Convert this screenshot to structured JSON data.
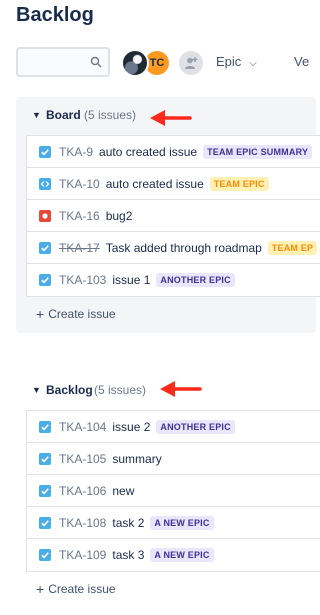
{
  "page": {
    "title": "Backlog"
  },
  "toolbar": {
    "search": {
      "value": "",
      "placeholder": ""
    },
    "avatars": [
      {
        "type": "photo"
      },
      {
        "type": "initials",
        "text": "TC",
        "color": "#ff991f"
      },
      {
        "type": "add-people"
      }
    ],
    "epic_filter": "Epic",
    "version_filter": "Ve"
  },
  "sprint": {
    "name": "Board",
    "count": "(5 issues)",
    "issues": [
      {
        "type": "story",
        "key": "TKA-9",
        "summary": "auto created issue",
        "epic": "TEAM EPIC SUMMARY",
        "epic_color": "purple",
        "done": false
      },
      {
        "type": "subtask",
        "key": "TKA-10",
        "summary": "auto created issue",
        "epic": "TEAM EPIC",
        "epic_color": "orange",
        "done": false
      },
      {
        "type": "bug",
        "key": "TKA-16",
        "summary": "bug2",
        "epic": "",
        "epic_color": "",
        "done": false
      },
      {
        "type": "story",
        "key": "TKA-17",
        "summary": "Task added through roadmap",
        "epic": "TEAM EP",
        "epic_color": "orange",
        "done": true
      },
      {
        "type": "story",
        "key": "TKA-103",
        "summary": "issue 1",
        "epic": "ANOTHER EPIC",
        "epic_color": "purple",
        "done": false
      }
    ],
    "create_label": "Create issue"
  },
  "backlog": {
    "name": "Backlog",
    "count": "(5 issues)",
    "issues": [
      {
        "type": "story",
        "key": "TKA-104",
        "summary": "issue 2",
        "epic": "ANOTHER EPIC",
        "epic_color": "purple",
        "done": false
      },
      {
        "type": "story",
        "key": "TKA-105",
        "summary": "summary",
        "epic": "",
        "epic_color": "",
        "done": false
      },
      {
        "type": "story",
        "key": "TKA-106",
        "summary": "new",
        "epic": "",
        "epic_color": "",
        "done": false
      },
      {
        "type": "story",
        "key": "TKA-108",
        "summary": "task 2",
        "epic": "A NEW EPIC",
        "epic_color": "purple",
        "done": false
      },
      {
        "type": "story",
        "key": "TKA-109",
        "summary": "task 3",
        "epic": "A NEW EPIC",
        "epic_color": "purple",
        "done": false
      }
    ],
    "create_label": "Create issue"
  },
  "colors": {
    "annotation_arrow": "#ff2a1a",
    "story_icon": "#4bade8",
    "bug_icon": "#e5493a"
  }
}
